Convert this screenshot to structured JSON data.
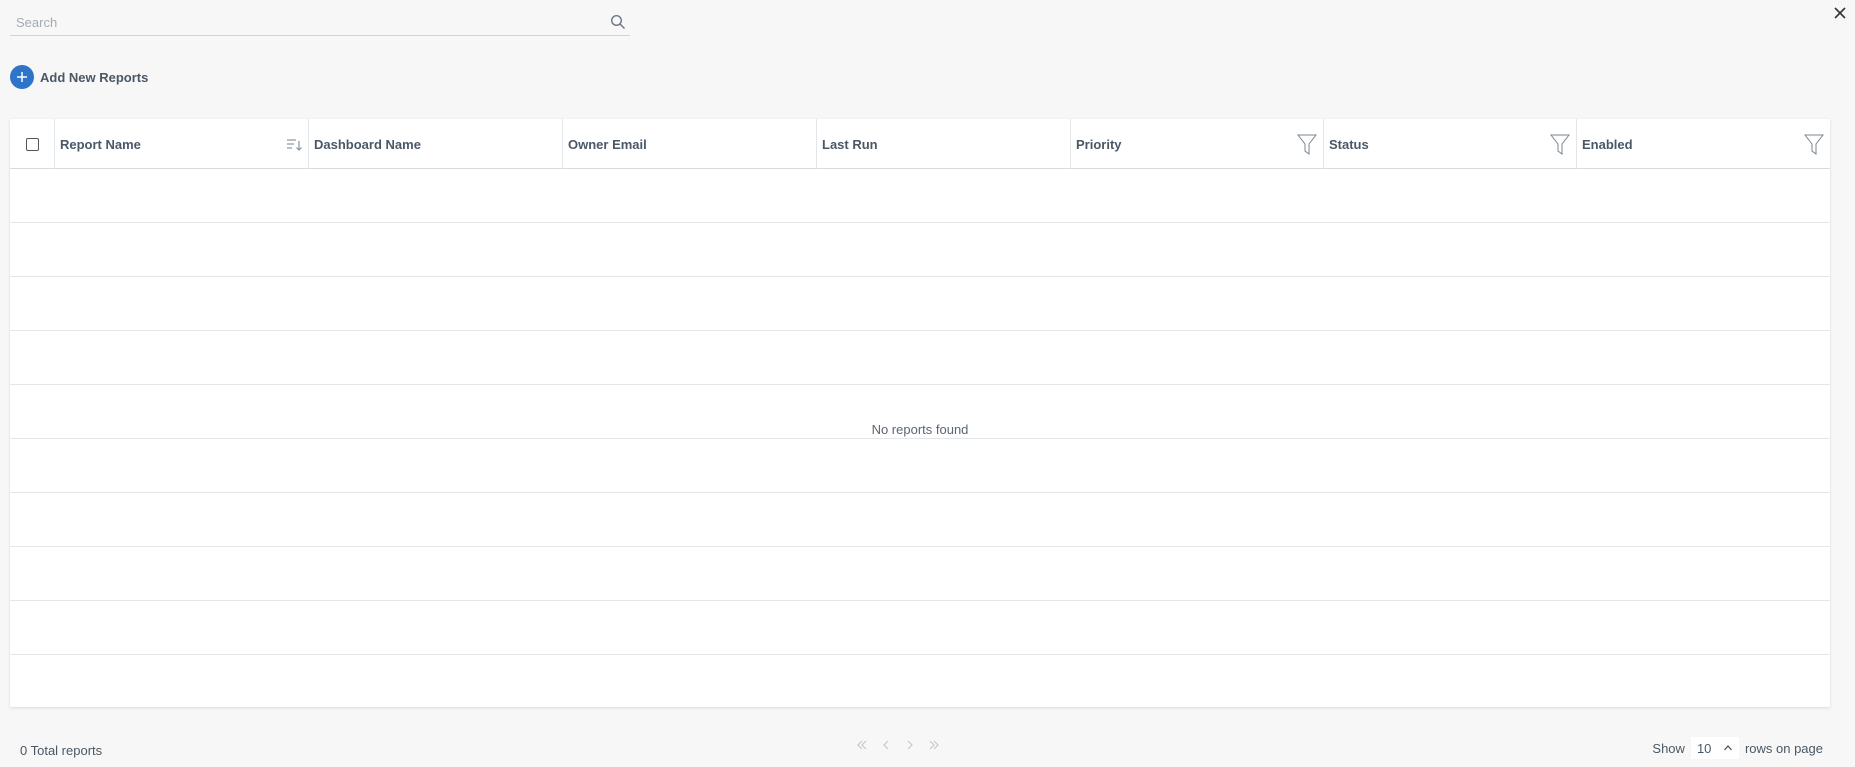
{
  "search": {
    "placeholder": "Search",
    "value": ""
  },
  "actions": {
    "add_label": "Add New Reports"
  },
  "table": {
    "columns": [
      {
        "label": "Report Name"
      },
      {
        "label": "Dashboard Name"
      },
      {
        "label": "Owner Email"
      },
      {
        "label": "Last Run"
      },
      {
        "label": "Priority"
      },
      {
        "label": "Status"
      },
      {
        "label": "Enabled"
      }
    ],
    "rows": [],
    "empty_message": "No reports found"
  },
  "footer": {
    "total_text": "0 Total reports",
    "show_label": "Show",
    "rows_per_page": "10",
    "rows_suffix": "rows on page"
  },
  "colors": {
    "accent": "#2e74c8",
    "background": "#f7f7f7"
  },
  "icons": [
    "search-icon",
    "close-icon",
    "plus-icon",
    "sort-icon",
    "filter-icon",
    "chevron-up-icon",
    "first-page-icon",
    "prev-page-icon",
    "next-page-icon",
    "last-page-icon"
  ]
}
